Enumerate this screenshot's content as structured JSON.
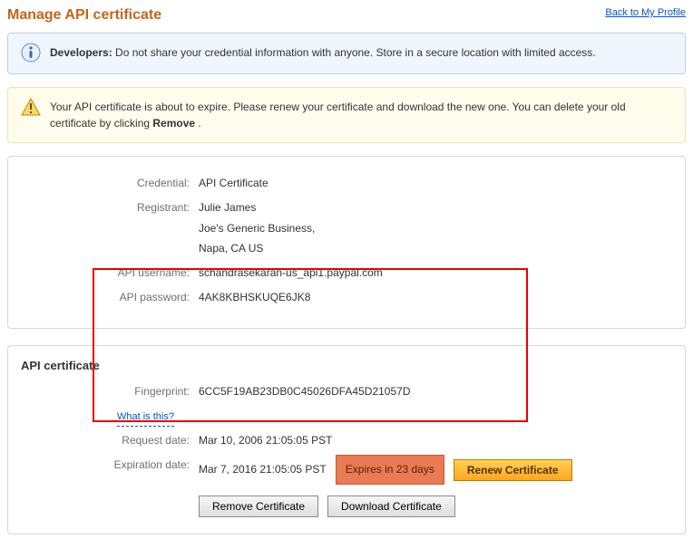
{
  "header": {
    "title": "Manage API certificate",
    "back_link": "Back to My Profile"
  },
  "alerts": {
    "info_prefix": "Developers:",
    "info_text": " Do not share your credential information with anyone. Store in a secure location with limited access.",
    "warn_text_a": "Your API certificate is about to expire. Please renew your certificate and download the new one. You can delete your old certificate by clicking ",
    "warn_text_bold": "Remove",
    "warn_text_b": " ."
  },
  "cred": {
    "credential_label": "Credential:",
    "credential_value": "API Certificate",
    "registrant_label": "Registrant:",
    "registrant_name": "Julie James",
    "registrant_biz": "Joe's Generic Business,",
    "registrant_loc": "Napa, CA US",
    "username_label": "API username:",
    "username_value": "schandrasekaran-us_api1.paypal.com",
    "password_label": "API password:",
    "password_value": "4AK8KBHSKUQE6JK8"
  },
  "cert": {
    "section_title": "API certificate",
    "fingerprint_label": "Fingerprint:",
    "fingerprint_value": "6CC5F19AB23DB0C45026DFA45D21057D",
    "what_is_this": "What is this?",
    "request_label": "Request date:",
    "request_value": "Mar 10, 2006 21:05:05 PST",
    "expire_label": "Expiration date:",
    "expire_value": "Mar 7, 2016 21:05:05 PST",
    "expire_badge": "Expires in 23 days",
    "renew_btn": "Renew Certificate",
    "remove_btn": "Remove Certificate",
    "download_btn": "Download Certificate"
  }
}
